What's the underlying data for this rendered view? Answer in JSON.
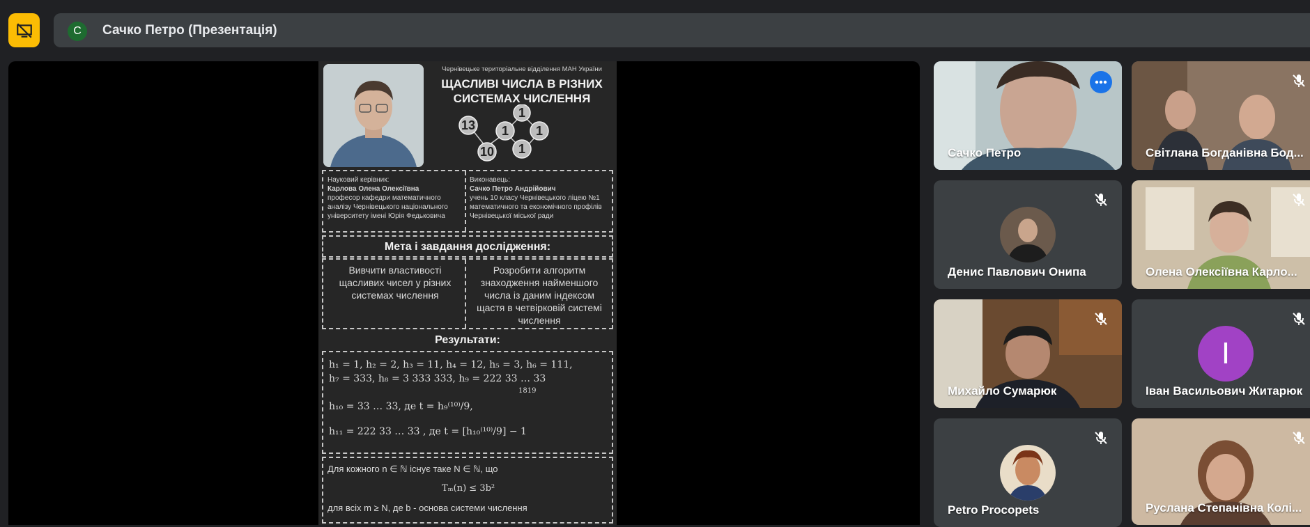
{
  "topbar": {
    "present_icon": "screen-share-off-icon",
    "presenter_initial": "C",
    "title": "Сачко Петро (Презентація)"
  },
  "slide": {
    "institution": "Чернівецьке територіальне відділення МАН України",
    "title_line1": "ЩАСЛИВІ ЧИСЛА В РІЗНИХ",
    "title_line2": "СИСТЕМАХ ЧИСЛЕННЯ",
    "diagram_numbers": [
      "13",
      "10",
      "1",
      "1",
      "1",
      "1"
    ],
    "supervisor": {
      "label": "Науковий керівник:",
      "name": "Карлова Олена Олексіївна",
      "desc": "професор кафедри математичного аналізу Чернівецького національного університету імені Юрія Федьковича"
    },
    "author": {
      "label": "Виконавець:",
      "name": "Сачко Петро Андрійович",
      "desc": "учень 10 класу Чернівецького ліцею №1 математичного та економічного профілів Чернівецької міської ради"
    },
    "goals_title": "Мета і завдання дослідження:",
    "goal1": "Вивчити властивості щасливих чисел у різних системах числення",
    "goal2": "Розробити алгоритм знаходження найменшого числа із даним індексом щастя в четвірковій системі числення",
    "results_title": "Результати:",
    "res_line1": "h₁ = 1, h₂ = 2, h₃ = 11,  h₄ = 12, h₅ = 3, h₆ = 111,",
    "res_line2": "h₇ = 333, h₈ = 3 333 333, h₉ = 222 33 … 33",
    "res_sub_1819": "1819",
    "res_line3": "h₁₀ = 33 … 33, де t = h₉⁽¹⁰⁾/9,",
    "res_line4": "h₁₁ = 222 33 … 33 ,  де  t = [h₁₀⁽¹⁰⁾/9] − 1",
    "thm_line1": "Для кожного n ∈ ℕ існує таке N ∈ ℕ, що",
    "thm_formula": "Tₘ(n) ≤ 3b²",
    "thm_line3": "для всіх m ≥ N, де b - основа системи числення"
  },
  "participants": [
    {
      "name": "Сачко Петро",
      "muted": false,
      "active": true
    },
    {
      "name": "Світлана Богданівна Бод...",
      "muted": true
    },
    {
      "name": "Денис Павлович Онипа",
      "muted": true
    },
    {
      "name": "Олена Олексіївна Карло...",
      "muted": true
    },
    {
      "name": "Михайло Сумарюк",
      "muted": true
    },
    {
      "name": "Іван Васильович Житарюк",
      "muted": true,
      "initial": "І",
      "avatar_color": "#a142c5"
    },
    {
      "name": "Petro Procopets",
      "muted": true
    },
    {
      "name": "Руслана Степанівна Колі...",
      "muted": true
    }
  ],
  "colors": {
    "accent": "#fbbc04",
    "active_border": "#8ab4f8",
    "more_button": "#1a73e8"
  }
}
